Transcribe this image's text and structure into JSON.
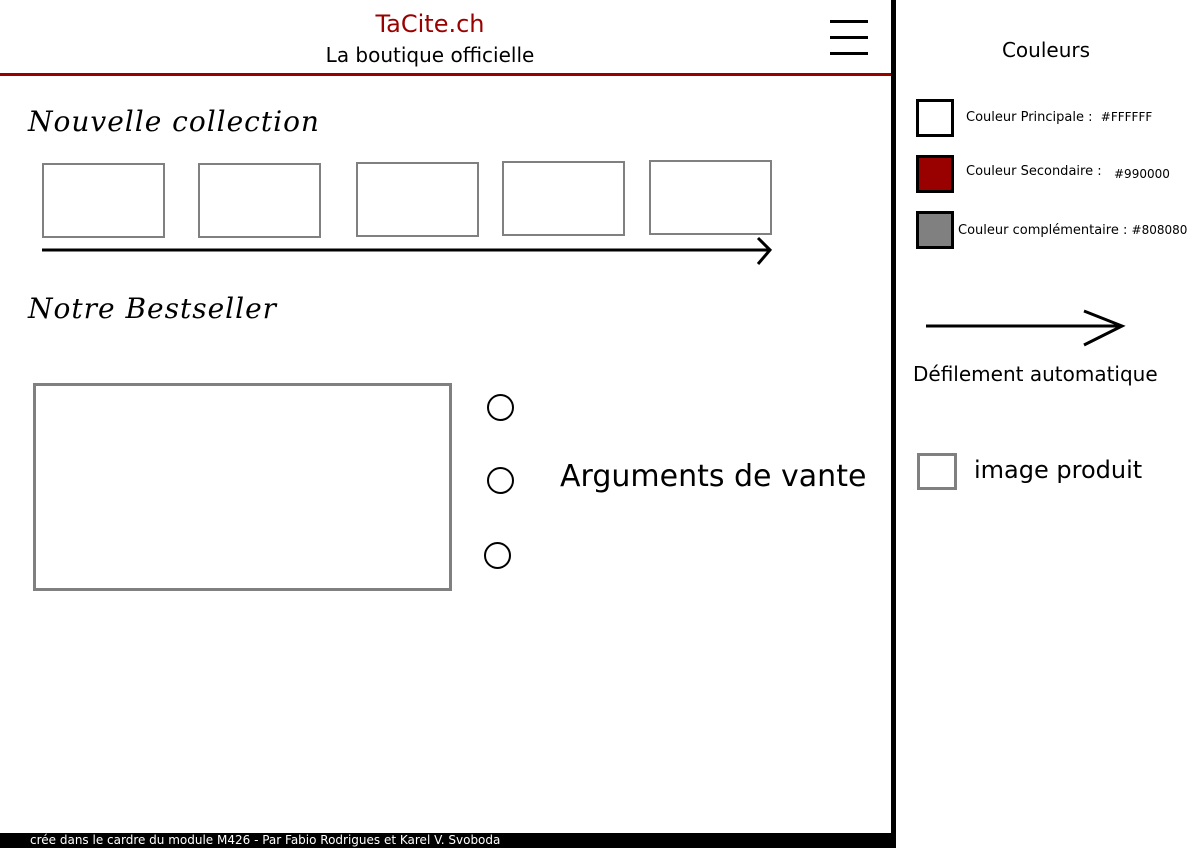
{
  "header": {
    "brand": "TaCite.ch",
    "tagline": "La boutique officielle",
    "menu_icon": "hamburger-menu-icon"
  },
  "collection": {
    "title": "Nouvelle collection",
    "item_count": 5,
    "indicator_icon": "arrow-right-icon"
  },
  "bestseller": {
    "title": "Notre Bestseller",
    "arguments_label": "Arguments de vante",
    "bullet_count": 3
  },
  "legend": {
    "title": "Couleurs",
    "colors": [
      {
        "label": "Couleur Principale :",
        "hex": "#FFFFFF"
      },
      {
        "label": "Couleur Secondaire :",
        "hex": "#990000"
      },
      {
        "label": "Couleur complémentaire :",
        "hex": "#808080"
      }
    ],
    "scroll_label": "Défilement automatique",
    "product_label": "image produit"
  },
  "footer": {
    "text": "crée dans le cardre du module M426 - Par Fabio Rodrigues et Karel V. Svoboda"
  },
  "palette": {
    "primary": "#FFFFFF",
    "secondary": "#990000",
    "complementary": "#808080"
  }
}
